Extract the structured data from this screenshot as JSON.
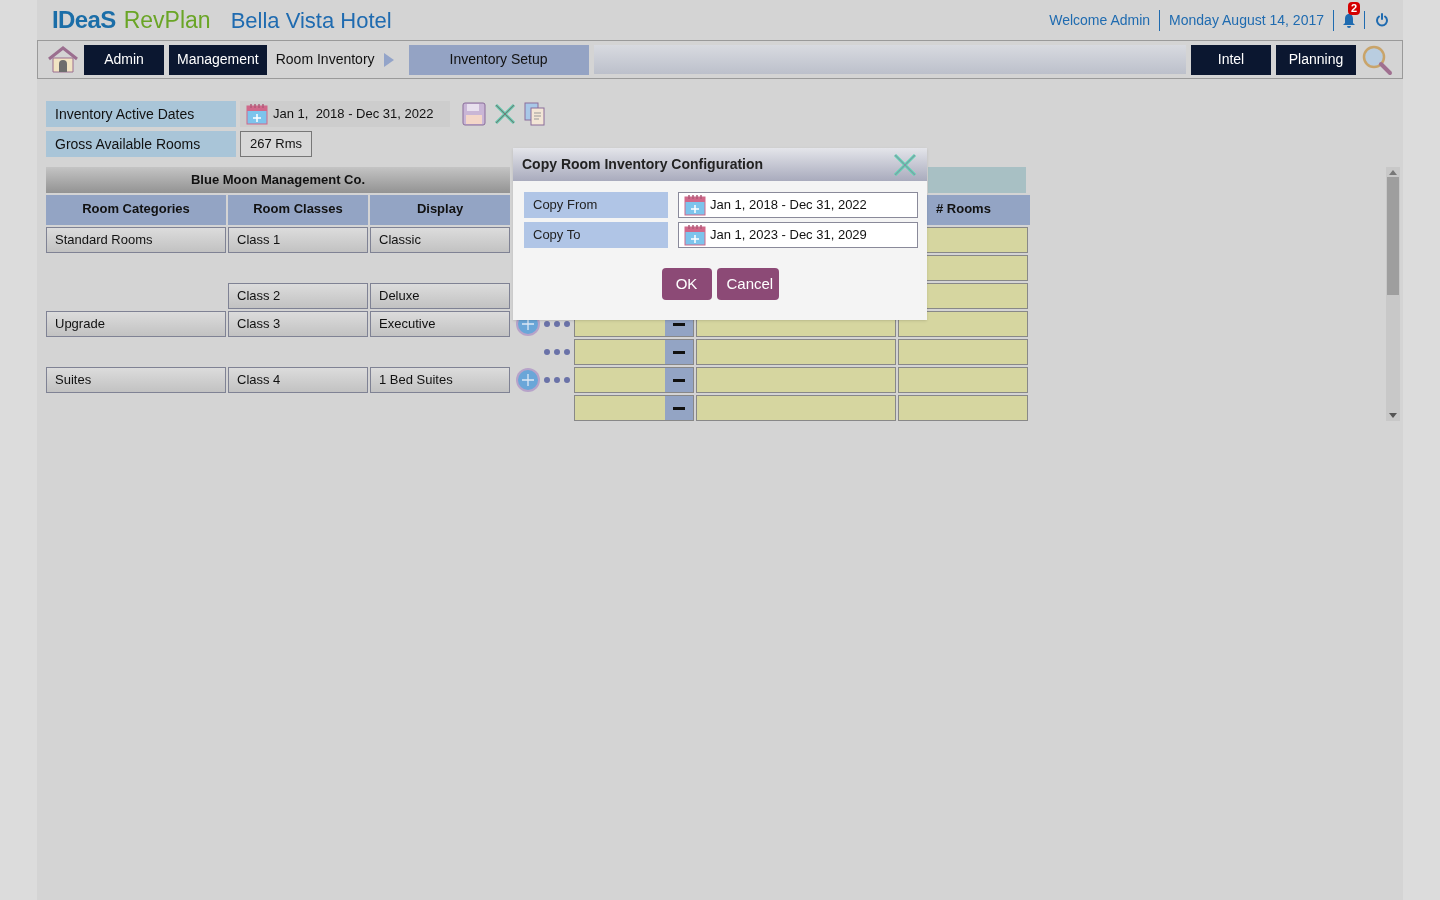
{
  "header": {
    "logo_primary": "IDeaS",
    "logo_secondary": "RevPlan",
    "hotel": "Bella Vista Hotel",
    "welcome": "Welcome Admin",
    "date": "Monday August 14, 2017",
    "notification_count": "2"
  },
  "nav": {
    "items": [
      {
        "label": "Admin",
        "kind": "button"
      },
      {
        "label": "Management",
        "kind": "button"
      },
      {
        "label": "Room Inventory",
        "kind": "crumb"
      },
      {
        "label": "Inventory Setup",
        "kind": "current"
      }
    ],
    "right_items": [
      {
        "label": "Intel"
      },
      {
        "label": "Planning"
      }
    ]
  },
  "settings": [
    {
      "label": "Inventory Active  Dates",
      "value": "Jan 1,  2018 - Dec 31, 2022",
      "kind": "date"
    },
    {
      "label": "Gross Available Rooms",
      "value": "267 Rms",
      "kind": "box"
    }
  ],
  "table": {
    "group": "Blue Moon Management Co.",
    "columns": [
      "Room Categories",
      "Room Classes",
      "Display"
    ],
    "right_column": "# Rooms",
    "rows": [
      {
        "category": "Standard Rooms",
        "class": "Class 1",
        "display": "Classic",
        "plus": false,
        "dots": false,
        "minus": false
      },
      {
        "plus": false,
        "dots": false,
        "minus": false
      },
      {
        "class": "Class 2",
        "display": "Deluxe",
        "plus": false,
        "dots": false,
        "minus": false
      },
      {
        "category": "Upgrade",
        "class": "Class 3",
        "display": "Executive",
        "plus": true,
        "dots": true,
        "minus": true
      },
      {
        "plus": false,
        "dots": true,
        "minus": true
      },
      {
        "category": "Suites",
        "class": "Class 4",
        "display": "1 Bed Suites",
        "plus": true,
        "dots": true,
        "minus": true
      },
      {
        "plus": false,
        "dots": false,
        "minus": true
      }
    ]
  },
  "dialog": {
    "title": "Copy Room Inventory Configuration",
    "fields": [
      {
        "label": "Copy From",
        "value": "Jan 1, 2018 - Dec 31, 2022"
      },
      {
        "label": "Copy To",
        "value": "Jan 1, 2023 - Dec 31, 2029"
      }
    ],
    "buttons": [
      "OK",
      "Cancel"
    ]
  }
}
